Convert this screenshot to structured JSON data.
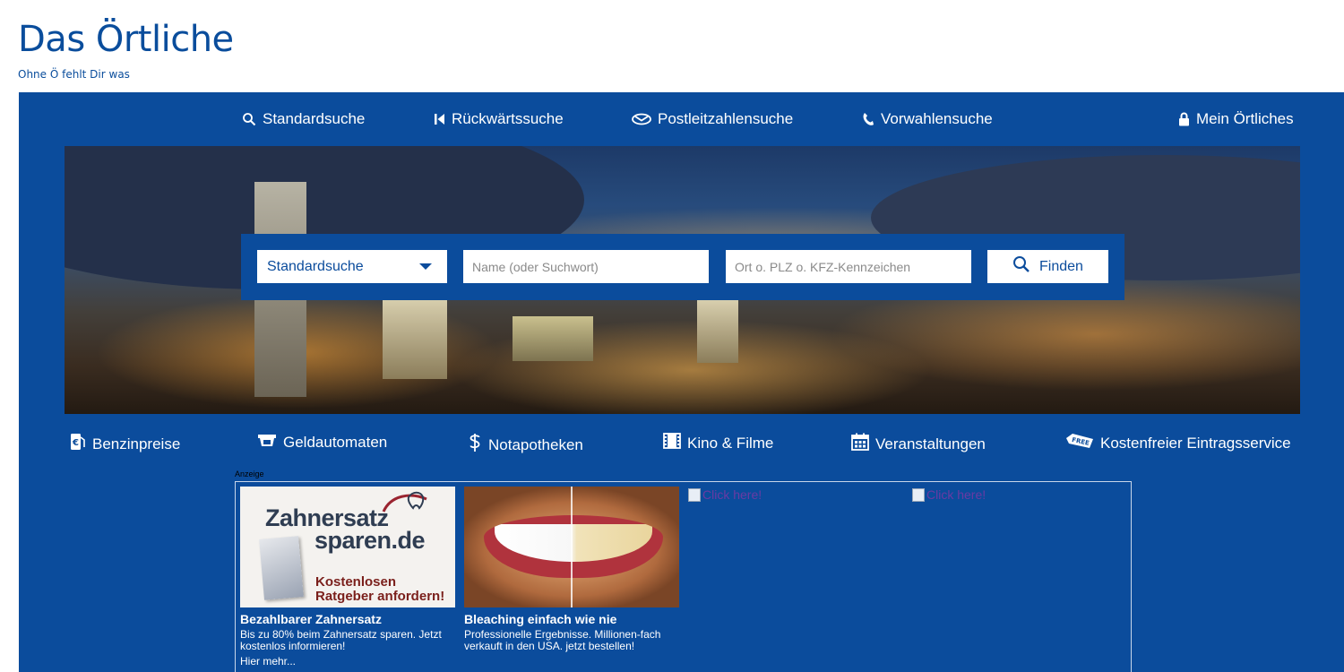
{
  "brand": {
    "title": "Das Örtliche",
    "tagline": "Ohne Ö fehlt Dir was",
    "color": "#0b4c9c"
  },
  "topnav": [
    {
      "label": "Standardsuche",
      "icon": "search-icon"
    },
    {
      "label": "Rückwärtssuche",
      "icon": "skip-back-icon"
    },
    {
      "label": "Postleitzahlensuche",
      "icon": "envelope-icon"
    },
    {
      "label": "Vorwahlensuche",
      "icon": "phone-icon"
    },
    {
      "label": "Mein Örtliches",
      "icon": "lock-icon"
    }
  ],
  "search": {
    "type_selected": "Standardsuche",
    "name_placeholder": "Name (oder Suchwort)",
    "name_value": "",
    "place_placeholder": "Ort o. PLZ o. KFZ-Kennzeichen",
    "place_value": "",
    "button_label": "Finden"
  },
  "subnav": [
    {
      "label": "Benzinpreise",
      "icon": "fuel-icon"
    },
    {
      "label": "Geldautomaten",
      "icon": "atm-icon"
    },
    {
      "label": "Notapotheken",
      "icon": "pharmacy-icon"
    },
    {
      "label": "Kino & Filme",
      "icon": "film-icon"
    },
    {
      "label": "Veranstaltungen",
      "icon": "calendar-icon"
    },
    {
      "label": "Kostenfreier Eintragsservice",
      "icon": "free-tag-icon"
    }
  ],
  "ads": {
    "label": "Anzeige",
    "items": [
      {
        "image_line1": "Zahnersatz",
        "image_line2": "sparen.de",
        "image_cta1": "Kostenlosen",
        "image_cta2": "Ratgeber anfordern!",
        "title": "Bezahlbarer Zahnersatz",
        "text": "Bis zu 80% beim Zahnersatz sparen. Jetzt kostenlos informieren!",
        "more": "Hier mehr..."
      },
      {
        "title": "Bleaching einfach wie nie",
        "text": "Professionelle Ergebnisse. Millionen-fach verkauft in den USA. jetzt bestellen!"
      }
    ],
    "broken_alt": [
      "Click here!",
      "Click here!"
    ]
  }
}
